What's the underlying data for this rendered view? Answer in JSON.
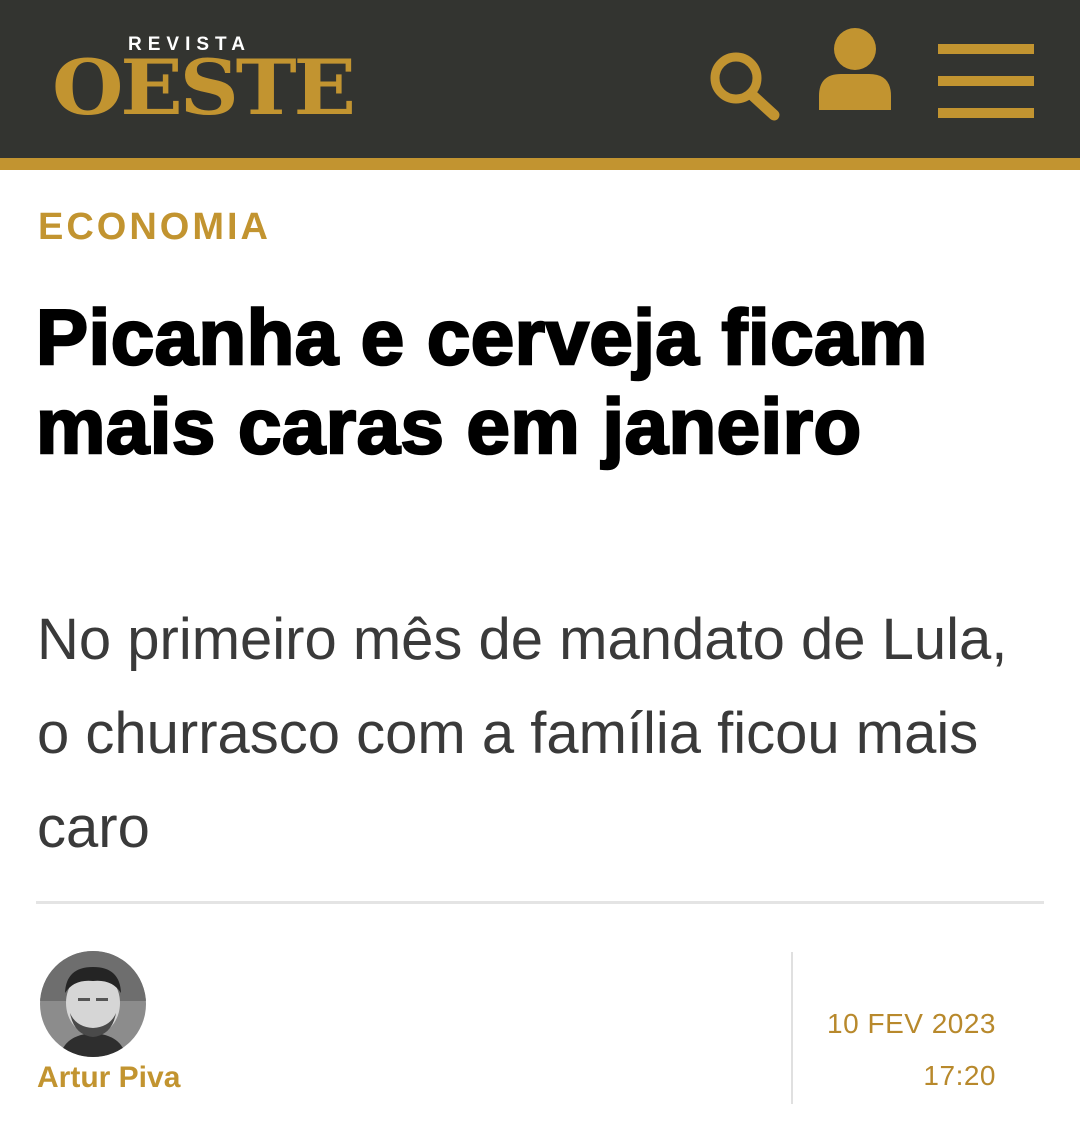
{
  "header": {
    "logo_small": "REVISTA",
    "logo_big": "OESTE",
    "icons": [
      "search-icon",
      "user-icon",
      "hamburger-menu-icon"
    ]
  },
  "article": {
    "category": "ECONOMIA",
    "headline": "Picanha e cerveja ficam mais caras em janeiro",
    "subtitle": "No primeiro mês de mandato de Lula, o churrasco com a família ficou mais caro",
    "author": "Artur Piva",
    "date": "10 FEV 2023",
    "time": "17:20"
  },
  "colors": {
    "header_bg": "#333430",
    "accent_gold": "#c29430",
    "headline": "#000000",
    "subtitle": "#3a3a3a"
  }
}
